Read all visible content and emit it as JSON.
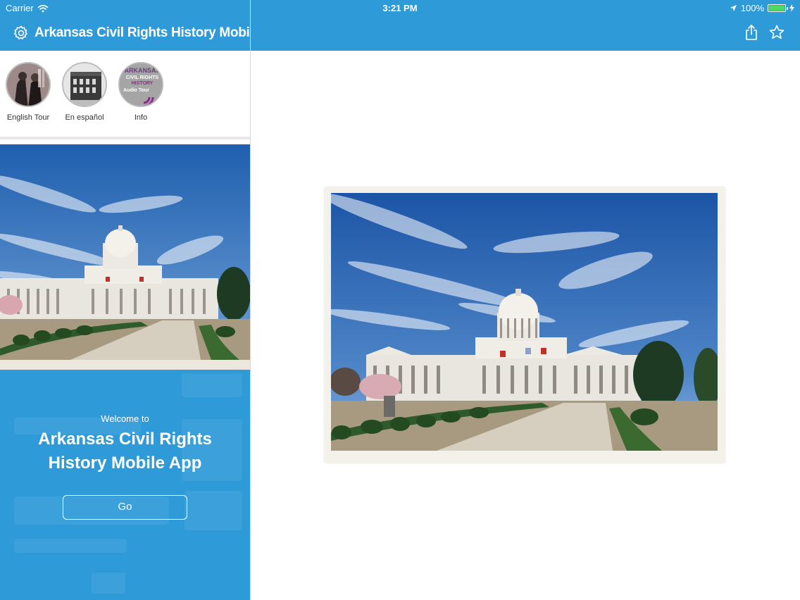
{
  "status_bar": {
    "carrier": "Carrier",
    "time": "3:21 PM",
    "battery": "100%"
  },
  "master": {
    "title": "Arkansas Civil Rights History Mobile App",
    "tours": [
      {
        "label": "English Tour"
      },
      {
        "label": "En español"
      },
      {
        "label": "Info",
        "badge_lines": [
          "ARKANSAS",
          "CIVIL RIGHTS",
          "HISTORY",
          "Audio Tour"
        ]
      }
    ],
    "welcome": {
      "intro": "Welcome to",
      "title": "Arkansas Civil Rights History Mobile App",
      "go_label": "Go"
    }
  },
  "detail": {
    "icons": {
      "share": "share-icon",
      "favorite": "star-icon"
    }
  },
  "colors": {
    "nav_blue": "#2e9ad8",
    "battery_green": "#4cd964",
    "sky_blue": "#2f6fb8"
  }
}
